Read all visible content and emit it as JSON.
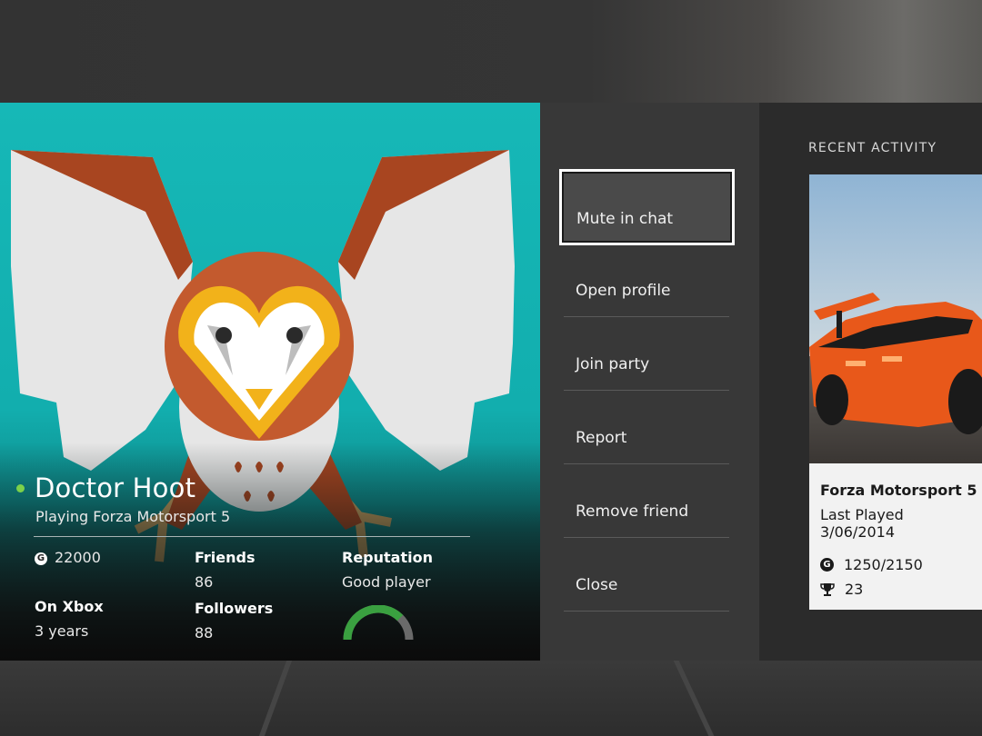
{
  "profile": {
    "gamertag": "Doctor Hoot",
    "status": "Playing Forza Motorsport 5",
    "gamerscore": "22000",
    "friends_label": "Friends",
    "friends_value": "86",
    "reputation_label": "Reputation",
    "reputation_value": "Good player",
    "reputation_level": 0.75,
    "on_xbox_label": "On Xbox",
    "on_xbox_value": "3 years",
    "followers_label": "Followers",
    "followers_value": "88",
    "presence_color": "#7cd14a",
    "card_color": "#16b8b7",
    "icons": {
      "gamerscore": "gamerscore-icon",
      "presence": "online-dot-icon"
    }
  },
  "menu": {
    "items": [
      {
        "label": "Mute in chat",
        "focused": true
      },
      {
        "label": "Open profile"
      },
      {
        "label": "Join party"
      },
      {
        "label": "Report"
      },
      {
        "label": "Remove friend"
      },
      {
        "label": "Close"
      }
    ]
  },
  "activity": {
    "heading": "RECENT ACTIVITY",
    "game": {
      "title": "Forza Motorsport 5",
      "last_played": "Last Played 3/06/2014",
      "gamerscore": "1250/2150",
      "achievements": "23"
    },
    "icons": {
      "gamerscore": "gamerscore-icon",
      "achievements": "trophy-icon"
    }
  }
}
